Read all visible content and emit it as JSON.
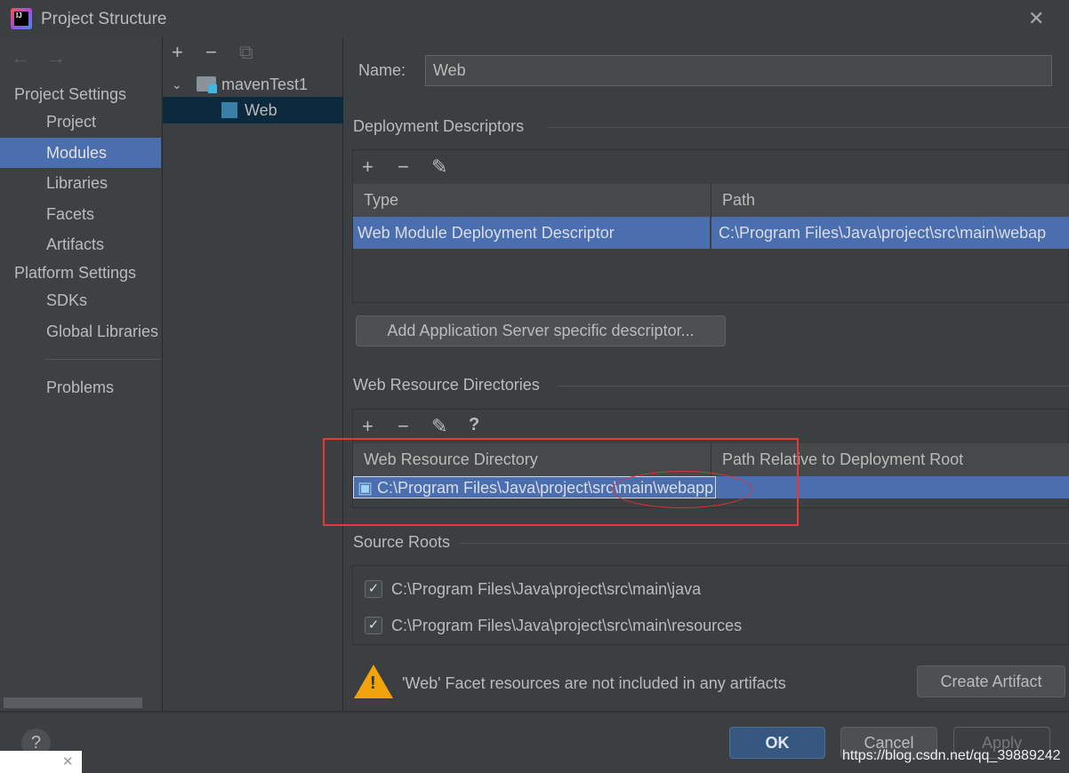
{
  "window": {
    "title": "Project Structure",
    "close": "✕"
  },
  "sidebar": {
    "project_settings": "Project Settings",
    "platform_settings": "Platform Settings",
    "items": [
      {
        "label": "Project"
      },
      {
        "label": "Modules",
        "selected": true
      },
      {
        "label": "Libraries"
      },
      {
        "label": "Facets"
      },
      {
        "label": "Artifacts"
      }
    ],
    "platform_items": [
      {
        "label": "SDKs"
      },
      {
        "label": "Global Libraries"
      }
    ],
    "problems": "Problems"
  },
  "tree": {
    "root": "mavenTest1",
    "child": "Web"
  },
  "main": {
    "name_label": "Name:",
    "name_value": "Web",
    "deployment": {
      "title": "Deployment Descriptors",
      "columns": [
        "Type",
        "Path"
      ],
      "rows": [
        [
          "Web Module Deployment Descriptor",
          "C:\\Program Files\\Java\\project\\src\\main\\webap"
        ]
      ],
      "add_server_button": "Add Application Server specific descriptor..."
    },
    "web_resources": {
      "title": "Web Resource Directories",
      "help": "?",
      "columns": [
        "Web Resource Directory",
        "Path Relative to Deployment Root"
      ],
      "rows": [
        [
          "C:\\Program Files\\Java\\project\\src\\main\\webapp",
          ""
        ]
      ]
    },
    "source_roots": {
      "title": "Source Roots",
      "items": [
        {
          "path": "C:\\Program Files\\Java\\project\\src\\main\\java",
          "checked": true
        },
        {
          "path": "C:\\Program Files\\Java\\project\\src\\main\\resources",
          "checked": true
        }
      ]
    },
    "warning": "'Web' Facet resources are not included in any artifacts",
    "create_artifact": "Create Artifact"
  },
  "footer": {
    "help": "?",
    "ok": "OK",
    "cancel": "Cancel",
    "apply": "Apply",
    "watermark": "https://blog.csdn.net/qq_39889242"
  },
  "colors": {
    "selection": "#4b6eaf",
    "tree_selection": "#0d293e",
    "annotation": "#e53935",
    "warning": "#f0a30a"
  }
}
